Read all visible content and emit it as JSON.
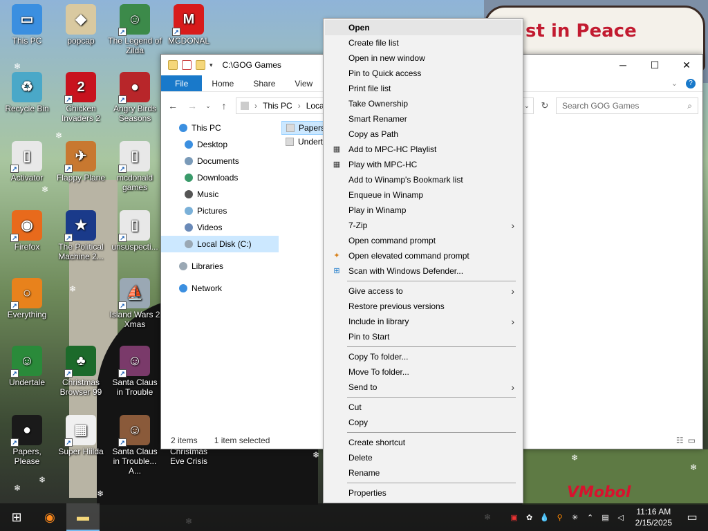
{
  "wallpaper": {
    "sign_text": "st in Peace",
    "watermark": "VMobol"
  },
  "desktop_icons": [
    {
      "label": "This PC",
      "color": "#3b8fe0",
      "glyph": "▭"
    },
    {
      "label": "popcap",
      "color": "#d9c9a0",
      "glyph": "◆"
    },
    {
      "label": "The Legend of Zilda",
      "color": "#3c8a4a",
      "glyph": "☺"
    },
    {
      "label": "MCDONAL",
      "color": "#d81b1b",
      "glyph": "M"
    },
    {
      "label": "Recycle Bin",
      "color": "#4aa8c8",
      "glyph": "♻"
    },
    {
      "label": "Chicken Invaders 2",
      "color": "#c8121e",
      "glyph": "2"
    },
    {
      "label": "Angry Birds Seasons",
      "color": "#b8262a",
      "glyph": "●"
    },
    {
      "label": "Activator",
      "color": "#e8e8e8",
      "glyph": "▯"
    },
    {
      "label": "Flappy Plane",
      "color": "#c87830",
      "glyph": "✈"
    },
    {
      "label": "mcdonald games",
      "color": "#e8e8e8",
      "glyph": "▯"
    },
    {
      "label": "Firefox",
      "color": "#e86a1c",
      "glyph": "◉"
    },
    {
      "label": "The Political Machine 2...",
      "color": "#1a3a8a",
      "glyph": "★"
    },
    {
      "label": "unsuspecti...",
      "color": "#e8e8e8",
      "glyph": "▯"
    },
    {
      "label": "Everything",
      "color": "#e8821c",
      "glyph": "○"
    },
    {
      "label": "Island Wars 2 Xmas",
      "color": "#9aa8b4",
      "glyph": "⛵"
    },
    {
      "label": "Undertale",
      "color": "#2a8a3a",
      "glyph": "☺"
    },
    {
      "label": "Christmas Browser 99",
      "color": "#1c6a2a",
      "glyph": "♣"
    },
    {
      "label": "Santa Claus in Trouble",
      "color": "#7a3a6a",
      "glyph": "☺"
    },
    {
      "label": "Papers, Please",
      "color": "#1a1a1a",
      "glyph": "●"
    },
    {
      "label": "Super Hiilda",
      "color": "#f0f0f0",
      "glyph": "▦"
    },
    {
      "label": "Santa Claus in Trouble... A...",
      "color": "#8a5a3a",
      "glyph": "☺"
    },
    {
      "label": "Christmas Eve Crisis",
      "color": "#2a2a2a",
      "glyph": ""
    }
  ],
  "explorer": {
    "title": "C:\\GOG Games",
    "tabs": [
      "File",
      "Home",
      "Share",
      "View"
    ],
    "address_parts": [
      "This PC",
      "Local"
    ],
    "search_placeholder": "Search GOG Games",
    "nav": [
      {
        "label": "This PC",
        "type": "root",
        "color": "#3b8fe0"
      },
      {
        "label": "Desktop",
        "type": "child",
        "color": "#3b8fe0"
      },
      {
        "label": "Documents",
        "type": "child",
        "color": "#7a9ab8"
      },
      {
        "label": "Downloads",
        "type": "child",
        "color": "#3a9a6a"
      },
      {
        "label": "Music",
        "type": "child",
        "color": "#555555"
      },
      {
        "label": "Pictures",
        "type": "child",
        "color": "#7ab0d8"
      },
      {
        "label": "Videos",
        "type": "child",
        "color": "#6a8ab8"
      },
      {
        "label": "Local Disk (C:)",
        "type": "child-selected",
        "color": "#9aa8b4"
      },
      {
        "label": "Libraries",
        "type": "root",
        "color": "#9aa8b4"
      },
      {
        "label": "Network",
        "type": "root",
        "color": "#3b8fe0"
      }
    ],
    "files": [
      {
        "name": "PapersP",
        "selected": true
      },
      {
        "name": "Undert",
        "selected": false
      }
    ],
    "status": {
      "item_count": "2 items",
      "selected": "1 item selected"
    }
  },
  "context_menu": {
    "groups": [
      [
        {
          "label": "Open",
          "bold": true,
          "icon": "",
          "submenu": false
        },
        {
          "label": "Create file list",
          "icon": "",
          "submenu": false
        },
        {
          "label": "Open in new window",
          "icon": "",
          "submenu": false
        },
        {
          "label": "Pin to Quick access",
          "icon": "",
          "submenu": false
        },
        {
          "label": "Print file list",
          "icon": "",
          "submenu": false
        },
        {
          "label": "Take Ownership",
          "icon": "",
          "submenu": false
        },
        {
          "label": "Smart Renamer",
          "icon": "",
          "submenu": false
        },
        {
          "label": "Copy as Path",
          "icon": "",
          "submenu": false
        },
        {
          "label": "Add to MPC-HC Playlist",
          "icon": "film",
          "submenu": false
        },
        {
          "label": "Play with MPC-HC",
          "icon": "film",
          "submenu": false
        },
        {
          "label": "Add to Winamp's Bookmark list",
          "icon": "",
          "submenu": false
        },
        {
          "label": "Enqueue in Winamp",
          "icon": "",
          "submenu": false
        },
        {
          "label": "Play in Winamp",
          "icon": "",
          "submenu": false
        },
        {
          "label": "7-Zip",
          "icon": "",
          "submenu": true
        },
        {
          "label": "Open command prompt",
          "icon": "",
          "submenu": false
        },
        {
          "label": "Open elevated command prompt",
          "icon": "shield",
          "submenu": false
        },
        {
          "label": "Scan with Windows Defender...",
          "icon": "defender",
          "submenu": false
        }
      ],
      [
        {
          "label": "Give access to",
          "icon": "",
          "submenu": true
        },
        {
          "label": "Restore previous versions",
          "icon": "",
          "submenu": false
        },
        {
          "label": "Include in library",
          "icon": "",
          "submenu": true
        },
        {
          "label": "Pin to Start",
          "icon": "",
          "submenu": false
        }
      ],
      [
        {
          "label": "Copy To folder...",
          "icon": "",
          "submenu": false
        },
        {
          "label": "Move To folder...",
          "icon": "",
          "submenu": false
        },
        {
          "label": "Send to",
          "icon": "",
          "submenu": true
        }
      ],
      [
        {
          "label": "Cut",
          "icon": "",
          "submenu": false
        },
        {
          "label": "Copy",
          "icon": "",
          "submenu": false
        }
      ],
      [
        {
          "label": "Create shortcut",
          "icon": "",
          "submenu": false
        },
        {
          "label": "Delete",
          "icon": "",
          "submenu": false
        },
        {
          "label": "Rename",
          "icon": "",
          "submenu": false
        }
      ],
      [
        {
          "label": "Properties",
          "icon": "",
          "submenu": false
        }
      ]
    ]
  },
  "taskbar": {
    "time": "11:16 AM",
    "date": "2/15/2025"
  },
  "colors": {
    "accent": "#1979ca",
    "selection": "#cce8ff",
    "menu_bg": "#f2f2f2"
  }
}
